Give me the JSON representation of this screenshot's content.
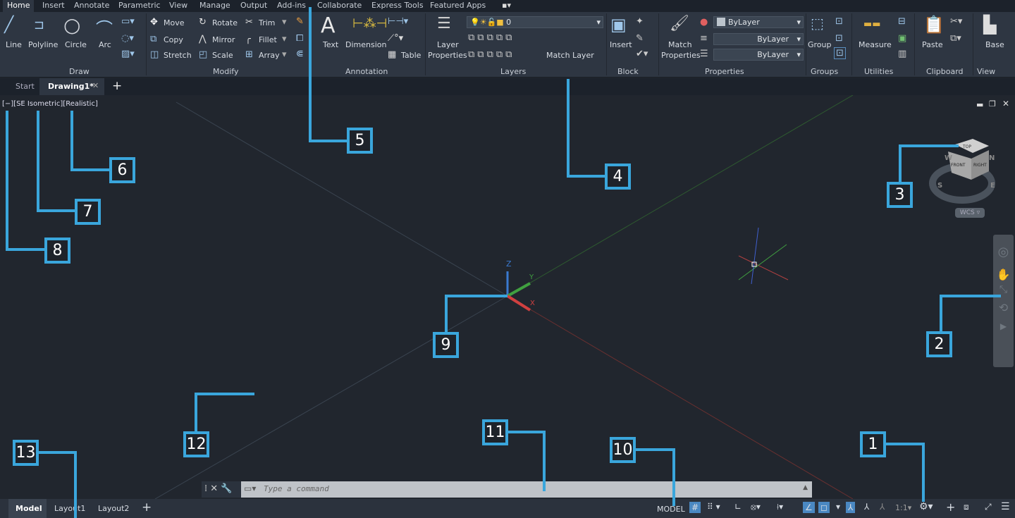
{
  "menu_tabs": [
    "Home",
    "Insert",
    "Annotate",
    "Parametric",
    "View",
    "Manage",
    "Output",
    "Add-ins",
    "Collaborate",
    "Express Tools",
    "Featured Apps"
  ],
  "active_menu_tab": "Home",
  "ribbon": {
    "draw": {
      "title": "Draw",
      "line": "Line",
      "polyline": "Polyline",
      "circle": "Circle",
      "arc": "Arc"
    },
    "modify": {
      "title": "Modify",
      "move": "Move",
      "copy": "Copy",
      "stretch": "Stretch",
      "rotate": "Rotate",
      "mirror": "Mirror",
      "scale": "Scale",
      "trim": "Trim",
      "fillet": "Fillet",
      "array": "Array"
    },
    "annotation": {
      "title": "Annotation",
      "text": "Text",
      "dimension": "Dimension",
      "table": "Table"
    },
    "layers": {
      "title": "Layers",
      "layer_properties_1": "Layer",
      "layer_properties_2": "Properties",
      "current_layer": "0",
      "match_layer": "Match Layer"
    },
    "block": {
      "title": "Block",
      "insert": "Insert"
    },
    "properties": {
      "title": "Properties",
      "match_1": "Match",
      "match_2": "Properties",
      "color": "ByLayer",
      "linetype": "ByLayer",
      "lineweight": "ByLayer"
    },
    "groups": {
      "title": "Groups",
      "group": "Group"
    },
    "utilities": {
      "title": "Utilities",
      "measure": "Measure"
    },
    "clipboard": {
      "title": "Clipboard",
      "paste": "Paste"
    },
    "view": {
      "title": "View",
      "base": "Base"
    }
  },
  "doc_tabs": [
    "Start",
    "Drawing1*"
  ],
  "viewport": {
    "controls": "[−][SE Isometric][Realistic]",
    "viewcube": {
      "top": "TOP",
      "front": "FRONT",
      "right": "RIGHT",
      "compass": [
        "N",
        "S",
        "E",
        "W"
      ],
      "wcs": "WCS"
    },
    "ucs": {
      "x": "X",
      "y": "Y",
      "z": "Z"
    }
  },
  "command_line": {
    "placeholder": "Type a command"
  },
  "layout_tabs": [
    "Model",
    "Layout1",
    "Layout2"
  ],
  "status": {
    "model": "MODEL",
    "scale": "1:1"
  },
  "callouts": [
    "1",
    "2",
    "3",
    "4",
    "5",
    "6",
    "7",
    "8",
    "9",
    "10",
    "11",
    "12",
    "13"
  ],
  "colors": {
    "accent": "#3aa6dc",
    "viewport_bg": "#21262e",
    "ribbon_bg": "#2e3642"
  }
}
